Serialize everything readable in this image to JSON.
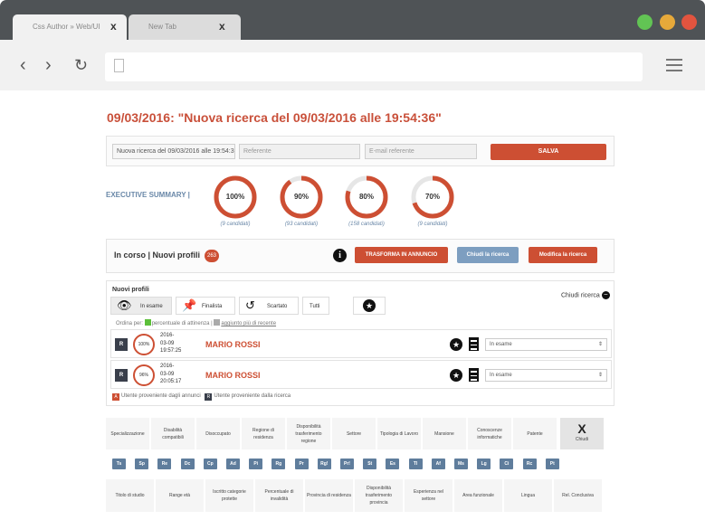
{
  "browser": {
    "tabs": [
      {
        "label": "Css Author » Web/UI",
        "close": "x"
      },
      {
        "label": "New Tab",
        "close": "x"
      }
    ],
    "nav": {
      "back": "‹",
      "forward": "›",
      "reload": "↻"
    }
  },
  "page": {
    "title": "09/03/2016: \"Nuova ricerca del 09/03/2016 alle 19:54:36\""
  },
  "form": {
    "search_name_value": "Nuova ricerca del 09/03/2016 alle 19:54:36",
    "referent_placeholder": "Referente",
    "email_placeholder": "E-mail referente",
    "save_label": "SALVA"
  },
  "executive_summary": {
    "label": "EXECUTIVE SUMMARY |",
    "gauges": [
      {
        "value": 100,
        "percent_label": "100%",
        "caption": "(9 candidati)"
      },
      {
        "value": 90,
        "percent_label": "90%",
        "caption": "(93 candidati)"
      },
      {
        "value": 80,
        "percent_label": "80%",
        "caption": "(158 candidati)"
      },
      {
        "value": 70,
        "percent_label": "70%",
        "caption": "(9 candidati)"
      }
    ]
  },
  "status": {
    "title": "In corso | Nuovi profili",
    "count": "263",
    "buttons": {
      "publish": "TRASFORMA IN ANNUNCIO",
      "close_search": "Chiudi la ricerca",
      "edit_search": "Modifica la ricerca"
    }
  },
  "profiles": {
    "title": "Nuovi profili",
    "close_label": "Chiudi ricerca",
    "tabs": [
      "In esame",
      "Finalista",
      "Scartato",
      "Tutti"
    ],
    "order_prefix": "Ordina per:",
    "order_option_1": "percentuale di attinenza",
    "order_separator": "|",
    "order_option_2": "aggiunto più di recente",
    "rows": [
      {
        "type": "R",
        "match": "100%",
        "date_1": "2016-",
        "date_2": "03-09",
        "time": "19:57:25",
        "name": "MARIO ROSSI",
        "status": "In esame"
      },
      {
        "type": "R",
        "match": "96%",
        "date_1": "2016-",
        "date_2": "03-09",
        "time": "20:05:17",
        "name": "MARIO ROSSI",
        "status": "In esame"
      }
    ],
    "legend": {
      "a_letter": "A",
      "a_text": "Utente proveniente dagli annunci",
      "r_letter": "R",
      "r_text": "Utente proveniente dalla ricerca"
    }
  },
  "filters": {
    "top": [
      "Specializzazione",
      "Disabilità compatibili",
      "Disoccupato",
      "Regione di residenza",
      "Disponibilità trasferimento regione",
      "Settore",
      "Tipologia di Lavoro",
      "Mansione",
      "Conoscenze informatiche",
      "Patente"
    ],
    "close_x": "X",
    "close_label": "Chiudi",
    "badges": [
      "Ts",
      "Sp",
      "Re",
      "Dc",
      "Cp",
      "Ad",
      "Pi",
      "Rg",
      "Pr",
      "Rg!",
      "Pr!",
      "St",
      "Es",
      "Tl",
      "Af",
      "Ms",
      "Lg",
      "Ci",
      "Rc",
      "Pt"
    ],
    "bottom": [
      "Titolo di studio",
      "Range età",
      "Iscritto categorie protette",
      "Percentuale di invalidità",
      "Provincia di residenza",
      "Disponibilità trasferimento provincia",
      "Esperienza nel settore",
      "Area funzionale",
      "Lingua",
      "Rel. Conclusiva"
    ]
  },
  "colors": {
    "accent": "#cd4f33",
    "secondary": "#7d9ec0",
    "badge": "#5f7d9c"
  }
}
